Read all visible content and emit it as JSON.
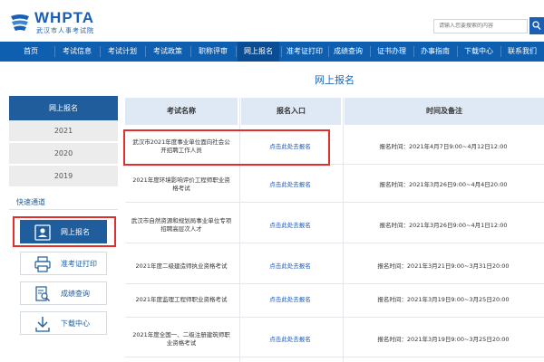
{
  "header": {
    "logo_en": "WHPTA",
    "logo_cn": "武汉市人事考试院",
    "search_placeholder": "请输入您要搜索的内容"
  },
  "nav": {
    "items": [
      {
        "label": "首页"
      },
      {
        "label": "考试信息"
      },
      {
        "label": "考试计划"
      },
      {
        "label": "考试政策"
      },
      {
        "label": "职称评审"
      },
      {
        "label": "网上报名",
        "active": true
      },
      {
        "label": "准考证打印"
      },
      {
        "label": "成绩查询"
      },
      {
        "label": "证书办理"
      },
      {
        "label": "办事指南"
      },
      {
        "label": "下载中心"
      },
      {
        "label": "联系我们"
      }
    ]
  },
  "page_title": "网上报名",
  "sidebar": {
    "head": "网上报名",
    "years": [
      "2021",
      "2020",
      "2019"
    ],
    "quick_title": "快速通道",
    "quick_items": [
      {
        "label": "网上报名",
        "icon": "register-icon",
        "active": true
      },
      {
        "label": "准考证打印",
        "icon": "printer-icon"
      },
      {
        "label": "成绩查询",
        "icon": "search-doc-icon"
      },
      {
        "label": "下载中心",
        "icon": "download-icon"
      }
    ]
  },
  "table": {
    "headers": [
      "考试名称",
      "报名入口",
      "时间及备注"
    ],
    "rows": [
      {
        "name": "武汉市2021年度事业单位面向社会公开招聘工作人员",
        "link": "点击此处去报名",
        "time": "报名时间：2021年4月7日9:00~4月12日12:00"
      },
      {
        "name": "2021年度环境影响评价工程师职业资格考试",
        "link": "点击此处去报名",
        "time": "报名时间：2021年3月26日9:00~4月4日20:00"
      },
      {
        "name": "武汉市自然资源和规划局事业单位专项招聘高层次人才",
        "link": "点击此处去报名",
        "time": "报名时间：2021年3月26日9:00~4月1日12:00"
      },
      {
        "name": "2021年度二级建造师执业资格考试",
        "link": "点击此处去报名",
        "time": "报名时间：2021年3月21日9:00~3月31日20:00"
      },
      {
        "name": "2021年度监理工程师职业资格考试",
        "link": "点击此处去报名",
        "time": "报名时间：2021年3月19日9:00~3月25日20:00"
      },
      {
        "name": "2021年度全国一、二级注册建筑师职业资格考试",
        "link": "点击此处去报名",
        "time": "报名时间：2021年3月19日9:00~3月25日20:00"
      }
    ]
  },
  "colors": {
    "brand_blue": "#0e5fb0",
    "highlight_red": "#e02f2f"
  }
}
